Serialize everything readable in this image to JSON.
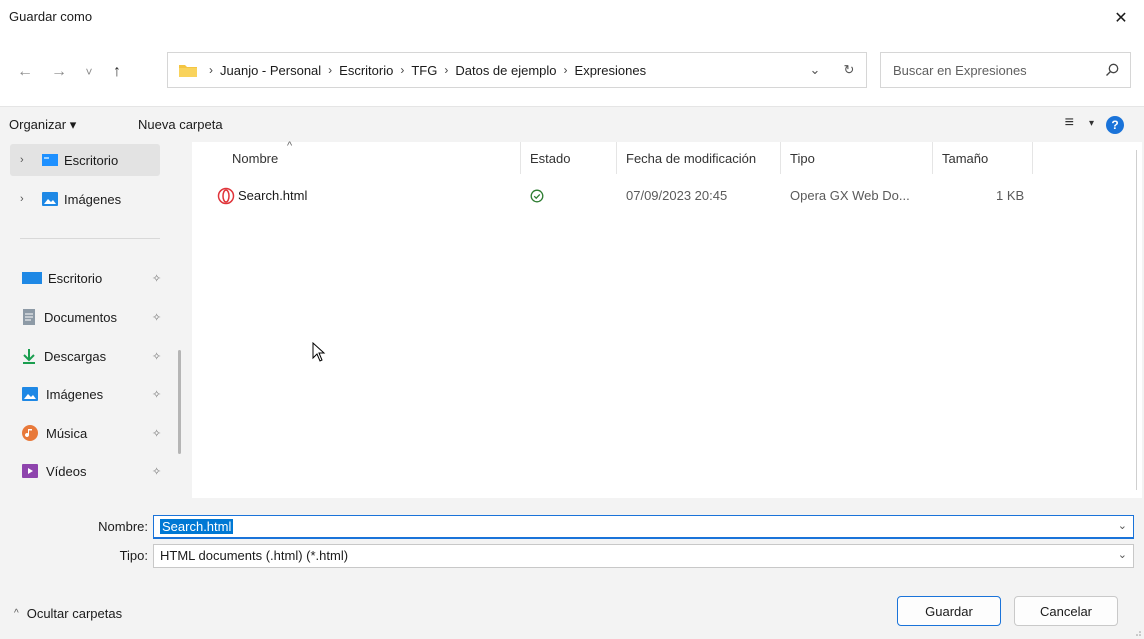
{
  "window": {
    "title": "Guardar como",
    "close_glyph": "✕"
  },
  "nav": {
    "back": "←",
    "forward": "→",
    "recent": "˅",
    "up": "↑",
    "breadcrumbs": [
      "Juanjo - Personal",
      "Escritorio",
      "TFG",
      "Datos de ejemplo",
      "Expresiones"
    ],
    "sep": "›",
    "dropdown_glyph": "⌄",
    "refresh_glyph": "↻",
    "search_placeholder": "Buscar en Expresiones"
  },
  "toolbar": {
    "organize": "Organizar ▾",
    "new_folder": "Nueva carpeta",
    "view_glyph": "≡",
    "view_caret": "▾",
    "help_glyph": "?"
  },
  "sidebar": {
    "tree": [
      {
        "label": "Escritorio",
        "chevron": "›",
        "icon": "desktop-folder-icon"
      },
      {
        "label": "Imágenes",
        "chevron": "›",
        "icon": "pictures-folder-icon"
      }
    ],
    "quick_access": [
      {
        "label": "Escritorio",
        "icon": "desktop-icon"
      },
      {
        "label": "Documentos",
        "icon": "documents-icon"
      },
      {
        "label": "Descargas",
        "icon": "downloads-icon"
      },
      {
        "label": "Imágenes",
        "icon": "pictures-icon"
      },
      {
        "label": "Música",
        "icon": "music-icon"
      },
      {
        "label": "Vídeos",
        "icon": "videos-icon"
      }
    ],
    "pin_glyph": "📌"
  },
  "columns": {
    "name": "Nombre",
    "status": "Estado",
    "date": "Fecha de modificación",
    "type": "Tipo",
    "size": "Tamaño",
    "sort_glyph": "^"
  },
  "files": [
    {
      "name": "Search.html",
      "status_icon": "synced-check-icon",
      "date": "07/09/2023 20:45",
      "type": "Opera GX Web Do...",
      "size": "1 KB"
    }
  ],
  "form": {
    "name_label": "Nombre:",
    "name_value": "Search.html",
    "type_label": "Tipo:",
    "type_value": "HTML documents (.html) (*.html)",
    "dd_glyph": "⌄"
  },
  "footer": {
    "hide_folders": "Ocultar carpetas",
    "hide_caret": "^",
    "save": "Guardar",
    "cancel": "Cancelar"
  },
  "colors": {
    "accent": "#1a73d9",
    "selection": "#0078d4",
    "status_green": "#2e7d32"
  }
}
